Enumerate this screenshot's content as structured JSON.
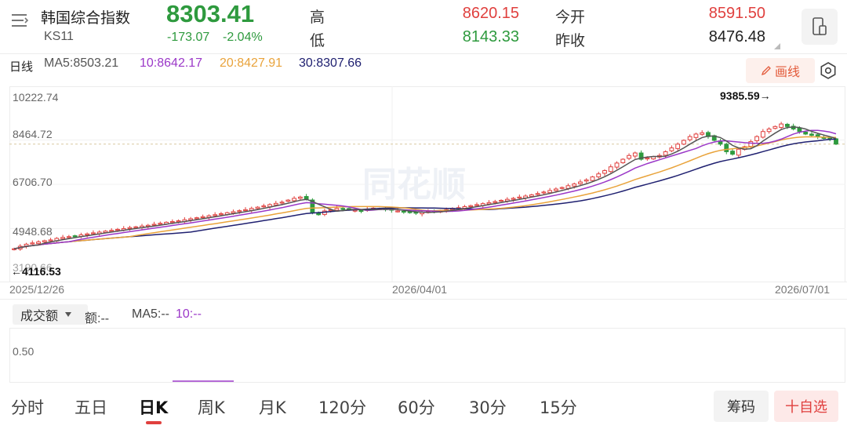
{
  "header": {
    "name": "韩国综合指数",
    "code": "KS11",
    "price": "8303.41",
    "change": "-173.07",
    "change_pct": "-2.04%",
    "high_label": "高",
    "high": "8620.15",
    "low_label": "低",
    "low": "8143.33",
    "open_label": "今开",
    "open": "8591.50",
    "prev_close_label": "昨收",
    "prev_close": "8476.48"
  },
  "ma": {
    "period_label": "日线",
    "ma5": "MA5:8503.21",
    "ma10": "10:8642.17",
    "ma20": "20:8427.91",
    "ma30": "30:8307.66",
    "draw_label": "画线"
  },
  "chart": {
    "y_ticks": [
      "10222.74",
      "8464.72",
      "6706.70",
      "4948.68",
      "3190.66"
    ],
    "x_ticks": [
      "2025/12/26",
      "2026/04/01",
      "2026/07/01"
    ],
    "max_marker": "9385.59→",
    "min_marker": "←4116.53",
    "watermark": "同花顺"
  },
  "chart_data": {
    "type": "candlestick",
    "ylim": [
      3190.66,
      10222.74
    ],
    "x_range": [
      "2025/12/26",
      "2026/07/01"
    ],
    "max": 9385.59,
    "min": 4116.53,
    "close": [
      4150,
      4250,
      4330,
      4380,
      4420,
      4470,
      4500,
      4560,
      4600,
      4630,
      4660,
      4700,
      4740,
      4780,
      4810,
      4850,
      4880,
      4920,
      4950,
      4990,
      5020,
      5050,
      5080,
      5120,
      5160,
      5200,
      5230,
      5260,
      5300,
      5340,
      5380,
      5420,
      5460,
      5500,
      5540,
      5580,
      5620,
      5660,
      5700,
      5750,
      5800,
      5850,
      5900,
      5950,
      6000,
      6080,
      6150,
      6200,
      6120,
      5600,
      5500,
      5650,
      5700,
      5750,
      5720,
      5700,
      5680,
      5660,
      5720,
      5760,
      5740,
      5700,
      5680,
      5650,
      5620,
      5580,
      5560,
      5600,
      5620,
      5640,
      5660,
      5700,
      5740,
      5780,
      5820,
      5860,
      5900,
      5940,
      5980,
      6020,
      6070,
      6110,
      6150,
      6200,
      6240,
      6290,
      6340,
      6400,
      6460,
      6520,
      6580,
      6650,
      6720,
      6800,
      6880,
      7000,
      7120,
      7250,
      7400,
      7550,
      7700,
      7850,
      7950,
      7700,
      7750,
      7800,
      7850,
      8000,
      8150,
      8300,
      8450,
      8600,
      8700,
      8750,
      8600,
      8450,
      8300,
      8000,
      7900,
      8100,
      8200,
      8400,
      8600,
      8800,
      8900,
      9000,
      9100,
      9000,
      8900,
      8800,
      8700,
      8650,
      8600,
      8550,
      8500,
      8303
    ]
  },
  "volume": {
    "select_label": "成交额",
    "amount": "额:--",
    "ma5": "MA5:--",
    "ma10": "10:--",
    "y_tick": "0.50"
  },
  "tabs": [
    "分时",
    "五日",
    "日K",
    "周K",
    "月K",
    "120分",
    "60分",
    "30分",
    "15分"
  ],
  "buttons": {
    "chip": "筹码",
    "watch": "十自选"
  },
  "colors": {
    "up": "#e0403e",
    "down": "#2e9a3e",
    "ma5": "#555555",
    "ma10": "#9b38c8",
    "ma20": "#e9a33b",
    "ma30": "#1f2070"
  }
}
